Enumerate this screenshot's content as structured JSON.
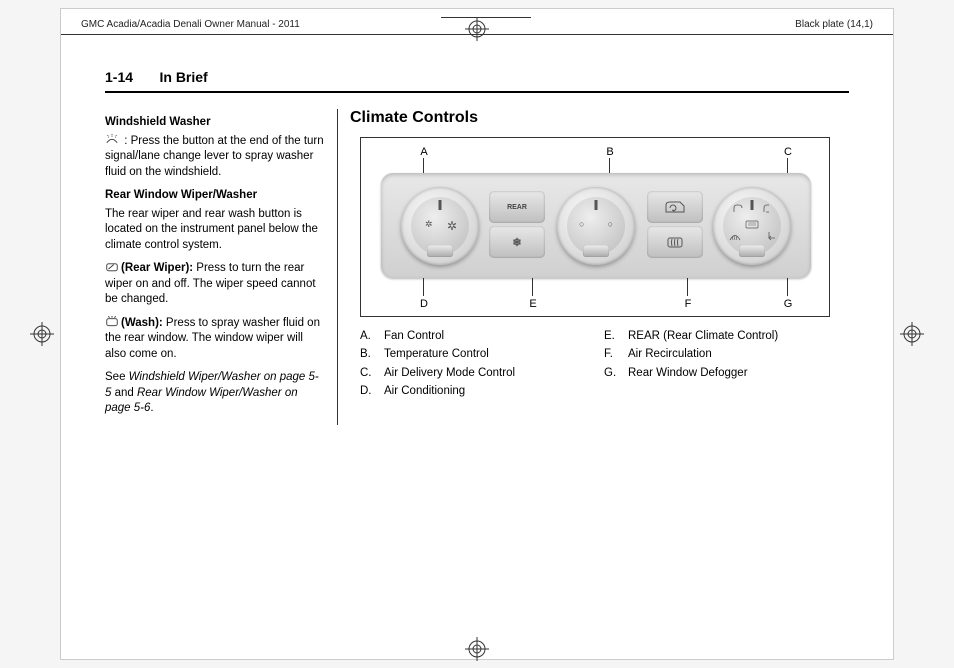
{
  "header": {
    "left": "GMC Acadia/Acadia Denali Owner Manual - 2011",
    "right": "Black plate (14,1)"
  },
  "section": {
    "page_number": "1-14",
    "title": "In Brief"
  },
  "left_column": {
    "washer_heading": "Windshield Washer",
    "washer_text": " :  Press the button at the end of the turn signal/lane change lever to spray washer fluid on the windshield.",
    "rear_heading": "Rear Window Wiper/Washer",
    "rear_para1": "The rear wiper and rear wash button is located on the instrument panel below the climate control system.",
    "rear_wiper_label": "(Rear Wiper):",
    "rear_wiper_text": "  Press to turn the rear wiper on and off. The wiper speed cannot be changed.",
    "wash_label": "(Wash):",
    "wash_text": "  Press to spray washer fluid on the rear window. The window wiper will also come on.",
    "see_prefix": "See ",
    "see_ref1": "Windshield Wiper/Washer on page 5-5",
    "see_mid": " and ",
    "see_ref2": "Rear Window Wiper/Washer on page 5-6",
    "see_suffix": "."
  },
  "right_column": {
    "heading": "Climate Controls",
    "labels": {
      "a": "A",
      "b": "B",
      "c": "C",
      "d": "D",
      "e": "E",
      "f": "F",
      "g": "G",
      "rear_btn": "REAR"
    },
    "legend_left": [
      {
        "letter": "A.",
        "text": "Fan Control"
      },
      {
        "letter": "B.",
        "text": "Temperature Control"
      },
      {
        "letter": "C.",
        "text": "Air Delivery Mode Control"
      },
      {
        "letter": "D.",
        "text": "Air Conditioning"
      }
    ],
    "legend_right": [
      {
        "letter": "E.",
        "text": "REAR (Rear Climate Control)"
      },
      {
        "letter": "F.",
        "text": "Air Recirculation"
      },
      {
        "letter": "G.",
        "text": "Rear Window Defogger"
      }
    ]
  }
}
